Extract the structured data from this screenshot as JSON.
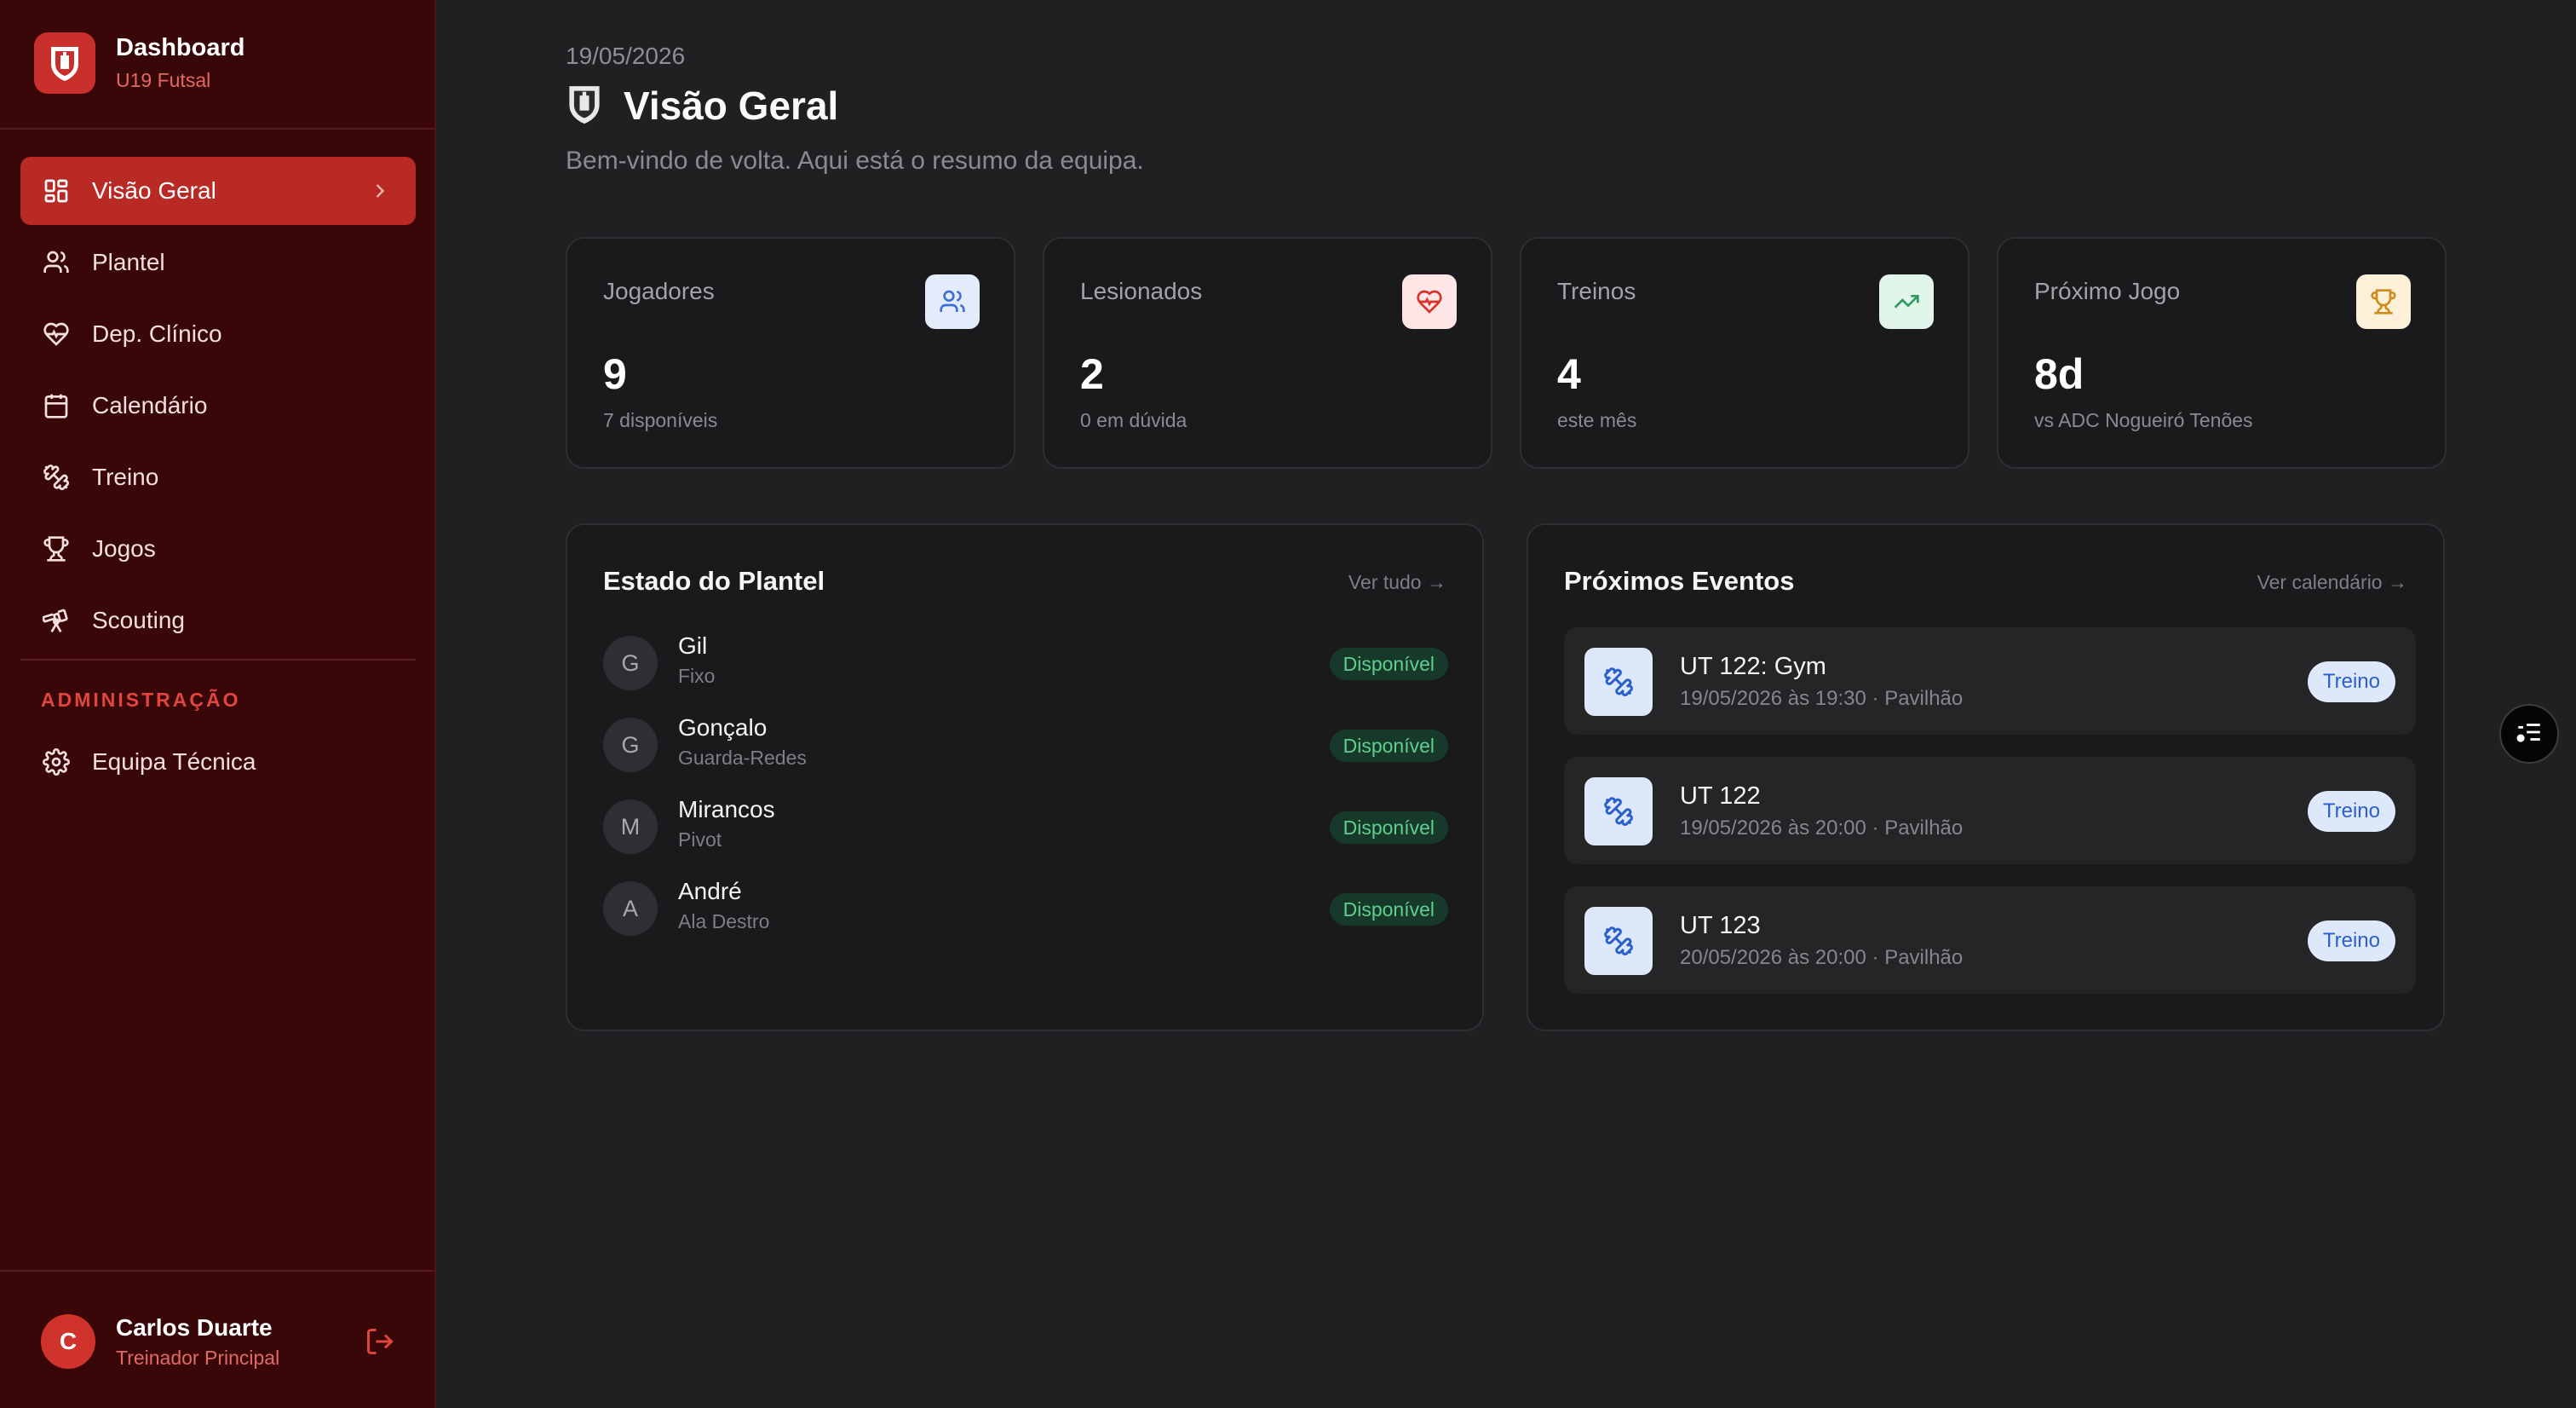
{
  "brand": {
    "title": "Dashboard",
    "subtitle": "U19 Futsal",
    "logo_icon": "club-crest-icon",
    "accent": "#c9302c"
  },
  "nav": {
    "items": [
      {
        "label": "Visão Geral",
        "icon": "grid-icon",
        "active": true
      },
      {
        "label": "Plantel",
        "icon": "users-icon"
      },
      {
        "label": "Dep. Clínico",
        "icon": "heart-pulse-icon"
      },
      {
        "label": "Calendário",
        "icon": "calendar-icon"
      },
      {
        "label": "Treino",
        "icon": "dumbbell-icon"
      },
      {
        "label": "Jogos",
        "icon": "trophy-icon"
      },
      {
        "label": "Scouting",
        "icon": "telescope-icon"
      }
    ],
    "admin_heading": "ADMINISTRAÇÃO",
    "admin_items": [
      {
        "label": "Equipa Técnica",
        "icon": "gear-icon"
      }
    ]
  },
  "user": {
    "initial": "C",
    "name": "Carlos Duarte",
    "role": "Treinador Principal"
  },
  "header": {
    "date": "19/05/2026",
    "title": "Visão Geral",
    "subtitle": "Bem-vindo de volta. Aqui está o resumo da equipa."
  },
  "stats": [
    {
      "label": "Jogadores",
      "value": "9",
      "note": "7 disponíveis",
      "icon": "users-icon",
      "color": "#3b6fd4"
    },
    {
      "label": "Lesionados",
      "value": "2",
      "note": "0 em dúvida",
      "icon": "heart-pulse-icon",
      "color": "#d7322c"
    },
    {
      "label": "Treinos",
      "value": "4",
      "note": "este mês",
      "icon": "trending-up-icon",
      "color": "#2e9a5e"
    },
    {
      "label": "Próximo Jogo",
      "value": "8d",
      "note": "vs ADC Nogueiró Tenões",
      "icon": "trophy-icon",
      "color": "#d08a1e"
    }
  ],
  "squad": {
    "title": "Estado do Plantel",
    "link": "Ver tudo →",
    "players": [
      {
        "initial": "G",
        "name": "Gil",
        "position": "Fixo",
        "status": "Disponível"
      },
      {
        "initial": "G",
        "name": "Gonçalo",
        "position": "Guarda-Redes",
        "status": "Disponível"
      },
      {
        "initial": "M",
        "name": "Mirancos",
        "position": "Pivot",
        "status": "Disponível"
      },
      {
        "initial": "A",
        "name": "André",
        "position": "Ala Destro",
        "status": "Disponível"
      }
    ]
  },
  "events": {
    "title": "Próximos Eventos",
    "link": "Ver calendário →",
    "items": [
      {
        "title": "UT 122: Gym",
        "details": "19/05/2026 às 19:30 · Pavilhão",
        "type": "Treino"
      },
      {
        "title": "UT 122",
        "details": "19/05/2026 às 20:00 · Pavilhão",
        "type": "Treino"
      },
      {
        "title": "UT 123",
        "details": "20/05/2026 às 20:00 · Pavilhão",
        "type": "Treino"
      }
    ]
  }
}
